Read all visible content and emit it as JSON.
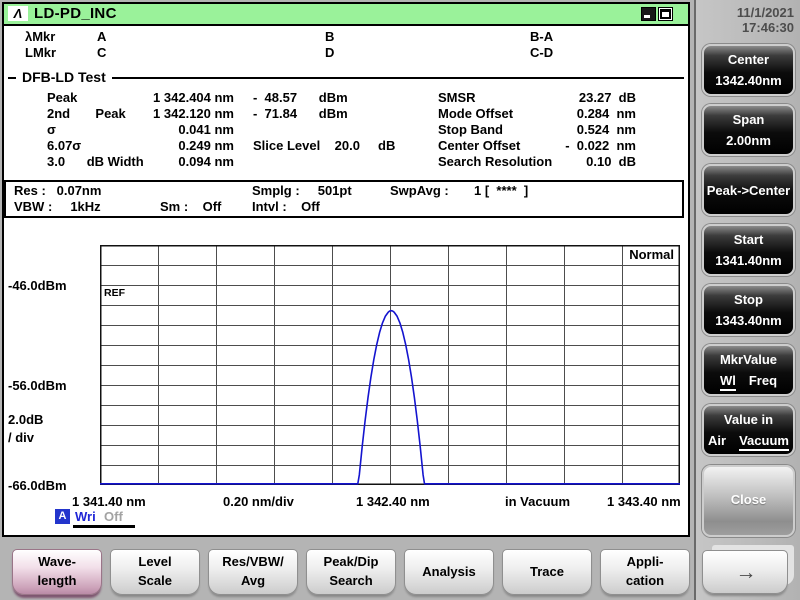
{
  "window": {
    "title": "LD-PD_INC",
    "logo_glyph": "Λ"
  },
  "markers": {
    "wl_label": "λMkr",
    "a": "A",
    "b": "B",
    "ba": "B-A",
    "lv_label": "LMkr",
    "c": "C",
    "d": "D",
    "cd": "C-D"
  },
  "analysis": {
    "section": "DFB-LD Test",
    "left": [
      {
        "name": "Peak",
        "value": "1 342.404 nm",
        "extra": "-  48.57      dBm"
      },
      {
        "name": "2nd       Peak",
        "value": "1 342.120 nm",
        "extra": "-  71.84      dBm"
      },
      {
        "name": "σ",
        "value": "0.041 nm",
        "extra": ""
      },
      {
        "name": "6.07σ",
        "value": "0.249 nm",
        "extra": "Slice Level    20.0     dB"
      },
      {
        "name": "3.0      dB Width",
        "value": "0.094 nm",
        "extra": ""
      }
    ],
    "right": [
      {
        "name": "SMSR",
        "value": "23.27  dB"
      },
      {
        "name": "Mode Offset",
        "value": "0.284  nm"
      },
      {
        "name": "Stop Band",
        "value": "0.524  nm"
      },
      {
        "name": "Center Offset",
        "value": "-  0.022  nm"
      },
      {
        "name": "Search Resolution",
        "value": "0.10  dB"
      }
    ]
  },
  "sweep": {
    "res": "Res :   0.07nm",
    "smplg": "Smplg :     501pt",
    "swpavg": "SwpAvg :       1 [  ****  ]",
    "vbw": "VBW :     1kHz",
    "sm": "Sm :    Off",
    "intvl": "Intvl :    Off"
  },
  "chart_data": {
    "type": "line",
    "mode_label": "Normal",
    "ref_label": "REF",
    "grid": true,
    "legend_position": "top-right",
    "x_axis": {
      "start_label": "1 341.40 nm",
      "div_label": "0.20 nm/div",
      "center_label": "1 342.40 nm",
      "medium_label": "in Vacuum",
      "stop_label": "1 343.40 nm",
      "min_nm": 1341.4,
      "max_nm": 1343.4,
      "nm_per_div": 0.2,
      "cols": 10
    },
    "y_axis": {
      "labels": [
        "-46.0dBm",
        "-56.0dBm",
        "-66.0dBm"
      ],
      "db_per_div_label": [
        "2.0dB",
        "/ div"
      ],
      "ref_dbm": -46.0,
      "top_dbm": -42.0,
      "bottom_dbm": -66.0,
      "db_per_div": 2.0,
      "rows": 12
    },
    "trace": {
      "name": "A",
      "mode": "Wri",
      "display": "Off",
      "color": "#1414cf",
      "peak_nm": 1342.404,
      "peak_dbm": -48.57,
      "width_3db_nm": 0.094,
      "points": [
        [
          1341.4,
          -66.3
        ],
        [
          1342.24,
          -66.3
        ],
        [
          1342.289,
          -66.3
        ],
        [
          1342.294,
          -65.0
        ],
        [
          1342.304,
          -62.15
        ],
        [
          1342.314,
          -59.57
        ],
        [
          1342.324,
          -57.26
        ],
        [
          1342.334,
          -55.22
        ],
        [
          1342.344,
          -53.46
        ],
        [
          1342.354,
          -51.97
        ],
        [
          1342.364,
          -50.74
        ],
        [
          1342.374,
          -49.79
        ],
        [
          1342.384,
          -49.11
        ],
        [
          1342.394,
          -48.71
        ],
        [
          1342.399,
          -48.6
        ],
        [
          1342.404,
          -48.57
        ],
        [
          1342.409,
          -48.6
        ],
        [
          1342.414,
          -48.71
        ],
        [
          1342.424,
          -49.11
        ],
        [
          1342.434,
          -49.79
        ],
        [
          1342.444,
          -50.74
        ],
        [
          1342.454,
          -51.97
        ],
        [
          1342.464,
          -53.46
        ],
        [
          1342.474,
          -55.22
        ],
        [
          1342.484,
          -57.26
        ],
        [
          1342.494,
          -59.57
        ],
        [
          1342.504,
          -62.15
        ],
        [
          1342.514,
          -65.0
        ],
        [
          1342.519,
          -66.3
        ],
        [
          1343.4,
          -66.3
        ]
      ]
    }
  },
  "sidebar": {
    "date": "11/1/2021",
    "time": "17:46:30",
    "keys": [
      {
        "line1": "Center",
        "line2": "1342.40nm"
      },
      {
        "line1": "Span",
        "line2": "2.00nm"
      },
      {
        "line1": "Peak->Center",
        "line2": ""
      },
      {
        "line1": "Start",
        "line2": "1341.40nm"
      },
      {
        "line1": "Stop",
        "line2": "1343.40nm"
      },
      {
        "line1": "MkrValue",
        "options": [
          "Wl",
          "Freq"
        ],
        "selected": "Wl"
      },
      {
        "line1": "Value in",
        "options": [
          "Air",
          "Vacuum"
        ],
        "selected": "Vacuum"
      },
      {
        "line1": "Close",
        "line2": ""
      }
    ]
  },
  "function_keys": [
    {
      "line1": "Wave-",
      "line2": "length",
      "active": true
    },
    {
      "line1": "Level",
      "line2": "Scale"
    },
    {
      "line1": "Res/VBW/",
      "line2": "Avg"
    },
    {
      "line1": "Peak/Dip",
      "line2": "Search"
    },
    {
      "line1": "Analysis"
    },
    {
      "line1": "Trace"
    },
    {
      "line1": "Appli-",
      "line2": "cation"
    },
    {
      "glyph": "→",
      "name": "more-keys"
    }
  ]
}
